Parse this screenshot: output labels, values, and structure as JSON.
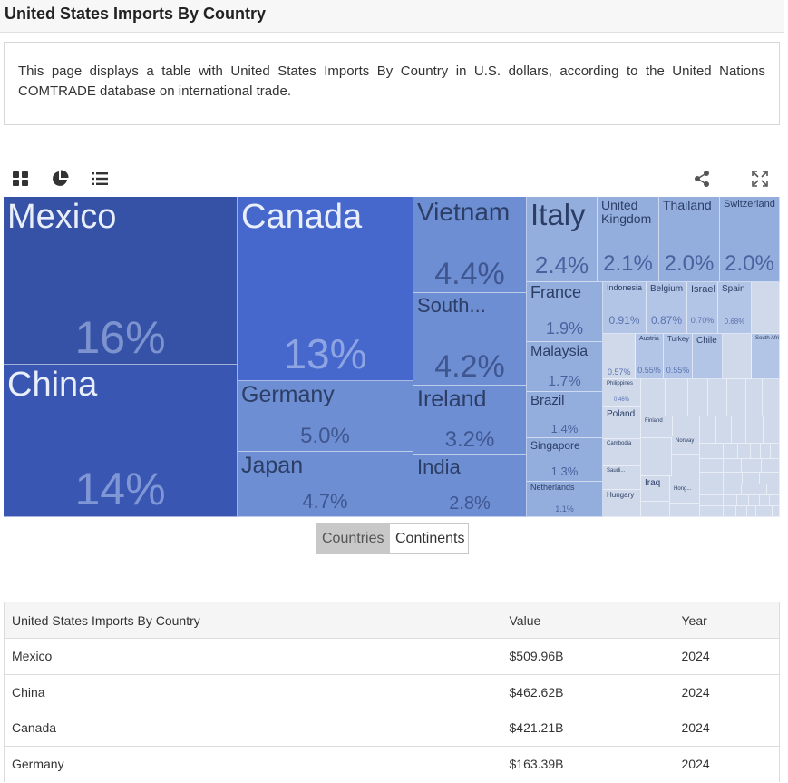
{
  "page": {
    "title": "United States Imports By Country",
    "description": "This page displays a table with United States Imports By Country in U.S. dollars, according to the United Nations COMTRADE database on international trade."
  },
  "toolbar": {
    "icons": [
      "treemap-view-icon",
      "pie-chart-view-icon",
      "list-view-icon",
      "share-icon",
      "fullscreen-icon"
    ]
  },
  "toggle": {
    "countries_label": "Countries",
    "continents_label": "Continents",
    "active": "Countries"
  },
  "colors": {
    "mexico": "#3652a6",
    "china": "#3a56b3",
    "canada": "#4667cc",
    "mid": "#6d8ed2",
    "light": "#93aedd",
    "lighter": "#b3c5e6",
    "lightest": "#cfd9ea"
  },
  "chart_data": {
    "type": "treemap",
    "title": "",
    "unit": "share of total imports (%)",
    "items": [
      {
        "name": "Mexico",
        "value": 16,
        "label": "16%"
      },
      {
        "name": "China",
        "value": 14,
        "label": "14%"
      },
      {
        "name": "Canada",
        "value": 13,
        "label": "13%"
      },
      {
        "name": "Germany",
        "value": 5.0,
        "label": "5.0%"
      },
      {
        "name": "Japan",
        "value": 4.7,
        "label": "4.7%"
      },
      {
        "name": "Vietnam",
        "value": 4.4,
        "label": "4.4%"
      },
      {
        "name": "South...",
        "value": 4.2,
        "label": "4.2%"
      },
      {
        "name": "Ireland",
        "value": 3.2,
        "label": "3.2%"
      },
      {
        "name": "India",
        "value": 2.8,
        "label": "2.8%"
      },
      {
        "name": "Italy",
        "value": 2.4,
        "label": "2.4%"
      },
      {
        "name": "France",
        "value": 1.9,
        "label": "1.9%"
      },
      {
        "name": "Malaysia",
        "value": 1.7,
        "label": "1.7%"
      },
      {
        "name": "Brazil",
        "value": 1.4,
        "label": "1.4%"
      },
      {
        "name": "Singapore",
        "value": 1.3,
        "label": "1.3%"
      },
      {
        "name": "Netherlands",
        "value": 1.1,
        "label": "1.1%"
      },
      {
        "name": "United Kingdom",
        "value": 2.1,
        "label": "2.1%"
      },
      {
        "name": "Thailand",
        "value": 2.0,
        "label": "2.0%"
      },
      {
        "name": "Switzerland",
        "value": 2.0,
        "label": "2.0%"
      },
      {
        "name": "Indonesia",
        "value": 0.91,
        "label": "0.91%"
      },
      {
        "name": "Belgium",
        "value": 0.87,
        "label": "0.87%"
      },
      {
        "name": "Israel",
        "value": 0.7,
        "label": "0.70%"
      },
      {
        "name": "Spain",
        "value": 0.68,
        "label": "0.68%"
      },
      {
        "name": "Austria",
        "value": 0.55,
        "label": "0.55%"
      },
      {
        "name": "Turkey",
        "value": 0.55,
        "label": "0.55%"
      },
      {
        "name": "Chile",
        "value": 0,
        "label": ""
      },
      {
        "name": "South Africa",
        "value": 0,
        "label": ""
      },
      {
        "name": "Philippines",
        "value": 0.46,
        "label": "0.46%"
      },
      {
        "name": "Poland",
        "value": 0,
        "label": ""
      },
      {
        "name": "Finland",
        "value": 0,
        "label": ""
      },
      {
        "name": "Norway",
        "value": 0,
        "label": ""
      },
      {
        "name": "Cambodia",
        "value": 0,
        "label": ""
      },
      {
        "name": "Saudi...",
        "value": 0,
        "label": ""
      },
      {
        "name": "Iraq",
        "value": 0,
        "label": ""
      },
      {
        "name": "Hong...",
        "value": 0,
        "label": ""
      },
      {
        "name": "Hungary",
        "value": 0,
        "label": ""
      }
    ],
    "extra_labels": [
      {
        "value": 0.57,
        "label": "0.57%"
      }
    ]
  },
  "table": {
    "headers": [
      "United States Imports By Country",
      "Value",
      "Year"
    ],
    "rows": [
      [
        "Mexico",
        "$509.96B",
        "2024"
      ],
      [
        "China",
        "$462.62B",
        "2024"
      ],
      [
        "Canada",
        "$421.21B",
        "2024"
      ],
      [
        "Germany",
        "$163.39B",
        "2024"
      ]
    ]
  }
}
